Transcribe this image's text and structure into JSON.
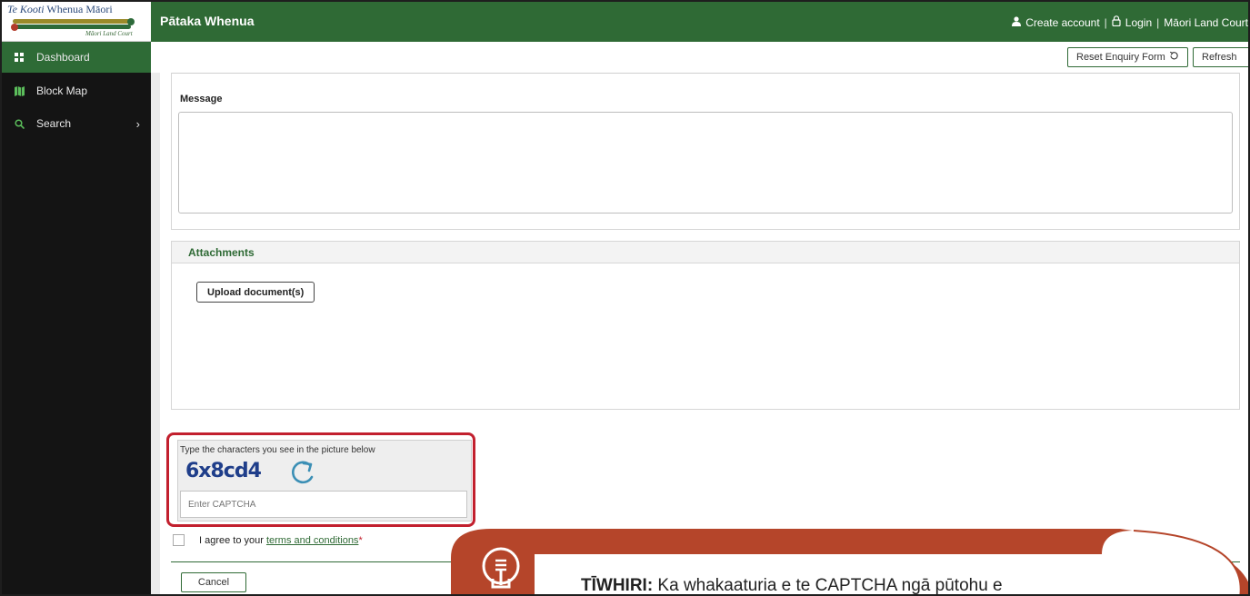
{
  "logo": {
    "title_italic": "Te Kooti",
    "title_rest": " Whenua Māori",
    "subtitle": "Māori Land Court"
  },
  "sidebar": {
    "items": [
      {
        "label": "Dashboard",
        "icon": "dashboard-icon"
      },
      {
        "label": "Block Map",
        "icon": "map-icon"
      },
      {
        "label": "Search",
        "icon": "search-icon"
      }
    ]
  },
  "header": {
    "title": "Pātaka Whenua",
    "create_account": "Create account",
    "login": "Login",
    "court": "Māori Land Court"
  },
  "toolbar": {
    "reset_label": "Reset Enquiry Form",
    "refresh_label": "Refresh"
  },
  "form": {
    "message_label": "Message",
    "attachments_title": "Attachments",
    "upload_label": "Upload document(s)",
    "captcha_instruction": "Type the characters you see in the picture below",
    "captcha_text": "6x8cd4",
    "captcha_placeholder": "Enter CAPTCHA",
    "agree_text": "I agree to your",
    "terms_link": "terms and conditions",
    "required_mark": "*",
    "cancel_label": "Cancel"
  },
  "tip": {
    "heading": "TĪWHIRI:",
    "body": " Ka whakaaturia e te CAPTCHA ngā pūtohu e"
  },
  "colors": {
    "brand_green": "#2f6a35",
    "sidebar_bg": "#141414",
    "highlight_red": "#c2202e",
    "tip_orange": "#b5452a"
  }
}
